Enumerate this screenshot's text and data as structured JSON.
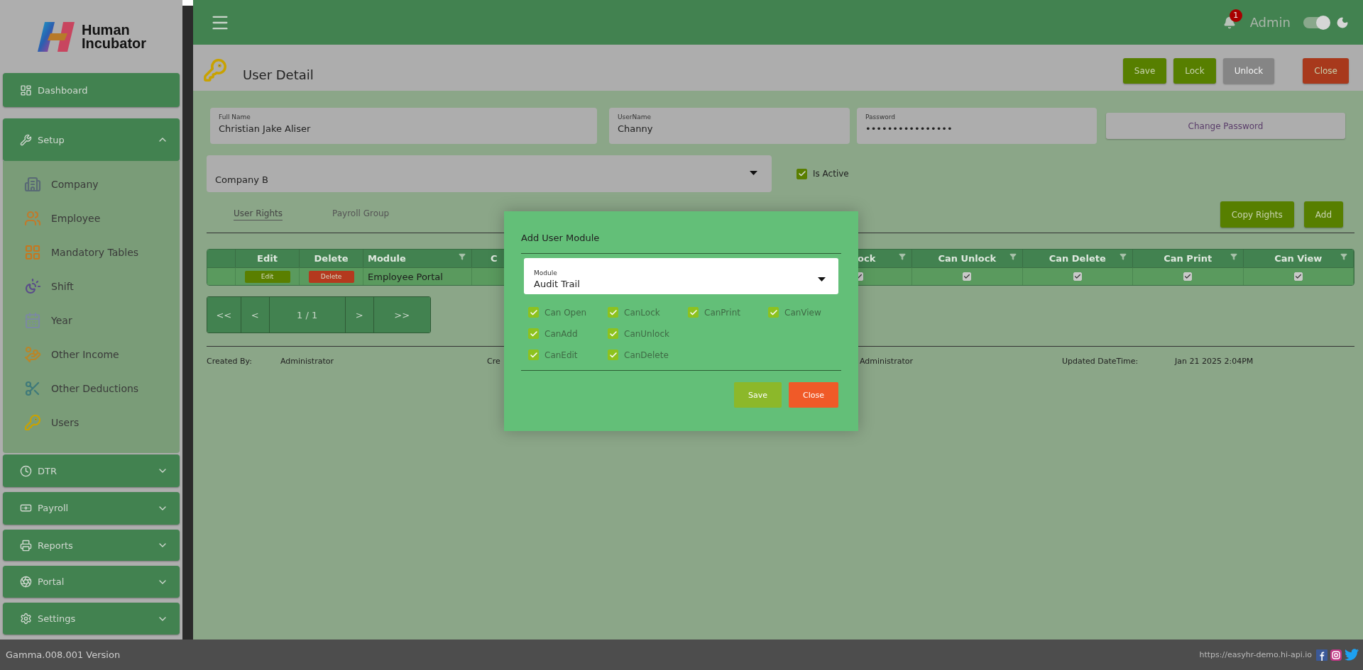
{
  "logo": {
    "lines": [
      "Human",
      "Incubator"
    ]
  },
  "sidebar": {
    "items": [
      {
        "label": "Dashboard",
        "kind": "link"
      },
      {
        "label": "Setup",
        "kind": "group",
        "expanded": true,
        "children": [
          {
            "label": "Company"
          },
          {
            "label": "Employee"
          },
          {
            "label": "Mandatory Tables"
          },
          {
            "label": "Shift"
          },
          {
            "label": "Year"
          },
          {
            "label": "Other Income"
          },
          {
            "label": "Other Deductions"
          },
          {
            "label": "Users"
          }
        ]
      },
      {
        "label": "DTR",
        "kind": "group",
        "expanded": false
      },
      {
        "label": "Payroll",
        "kind": "group",
        "expanded": false
      },
      {
        "label": "Reports",
        "kind": "group",
        "expanded": false
      },
      {
        "label": "Portal",
        "kind": "group",
        "expanded": false
      },
      {
        "label": "Settings",
        "kind": "group",
        "expanded": false
      }
    ]
  },
  "header": {
    "notifications": "1",
    "user": "Admin",
    "dark_mode": {
      "on": true
    }
  },
  "page": {
    "title": "User Detail",
    "actions": [
      {
        "label": "Save",
        "kind": "primary",
        "disabled": false
      },
      {
        "label": "Lock",
        "kind": "primary",
        "disabled": false
      },
      {
        "label": "Unlock",
        "kind": "primary",
        "disabled": true
      },
      {
        "label": "Close",
        "kind": "danger",
        "disabled": false
      }
    ]
  },
  "form": {
    "fields": [
      {
        "label": "Full Name",
        "value": "Christian Jake Aliser"
      },
      {
        "label": "UserName",
        "value": "Channy"
      },
      {
        "label": "Password",
        "value": "••••••••••••••••"
      }
    ],
    "change_password": "Change Password",
    "company": {
      "value": "Company B"
    },
    "is_active": {
      "label": "Is Active",
      "checked": true
    }
  },
  "tabs": [
    {
      "label": "User Rights",
      "selected": true
    },
    {
      "label": "Payroll Group",
      "selected": false
    }
  ],
  "tab_actions": [
    "Copy Rights",
    "Add"
  ],
  "table": {
    "columns": [
      {
        "label": "Edit",
        "filter": false
      },
      {
        "label": "Delete",
        "filter": false
      },
      {
        "label": "Module",
        "filter": true
      },
      {
        "label": "C"
      },
      {
        "label": "ock",
        "filter": true
      },
      {
        "label": "Can Unlock",
        "filter": true
      },
      {
        "label": "Can Delete",
        "filter": true
      },
      {
        "label": "Can Print",
        "filter": true
      },
      {
        "label": "Can View",
        "filter": true
      }
    ],
    "rows": [
      {
        "edit": "Edit",
        "delete": "Delete",
        "module": "Employee Portal",
        "rights": [
          {
            "checked": true
          },
          {
            "checked": true
          },
          {
            "checked": true
          },
          {
            "checked": true
          },
          {
            "checked": true
          }
        ]
      }
    ]
  },
  "pager": {
    "first": "<<",
    "prev": "<",
    "page": "1 / 1",
    "next": ">",
    "last": ">>"
  },
  "audit": [
    "Created By:",
    "Administrator",
    "Cre",
    "Administrator",
    "Updated DateTime:",
    "Jan 21 2025 2:04PM"
  ],
  "modal": {
    "title": "Add User Module",
    "module": {
      "label": "Module",
      "value": "Audit Trail"
    },
    "rights": [
      [
        {
          "label": "Can Open",
          "checked": true
        },
        {
          "label": "CanLock",
          "checked": true
        },
        {
          "label": "CanPrint",
          "checked": true
        },
        {
          "label": "CanView",
          "checked": true
        }
      ],
      [
        {
          "label": "CanAdd",
          "checked": true
        },
        {
          "label": "CanUnlock",
          "checked": true
        }
      ],
      [
        {
          "label": "CanEdit",
          "checked": true
        },
        {
          "label": "CanDelete",
          "checked": true
        }
      ]
    ],
    "buttons": [
      {
        "label": "Save",
        "kind": "primary"
      },
      {
        "label": "Close",
        "kind": "danger"
      }
    ]
  },
  "status_bar": {
    "version": "Gamma.008.001 Version",
    "url": "https://easyhr-demo.hi-api.io"
  }
}
